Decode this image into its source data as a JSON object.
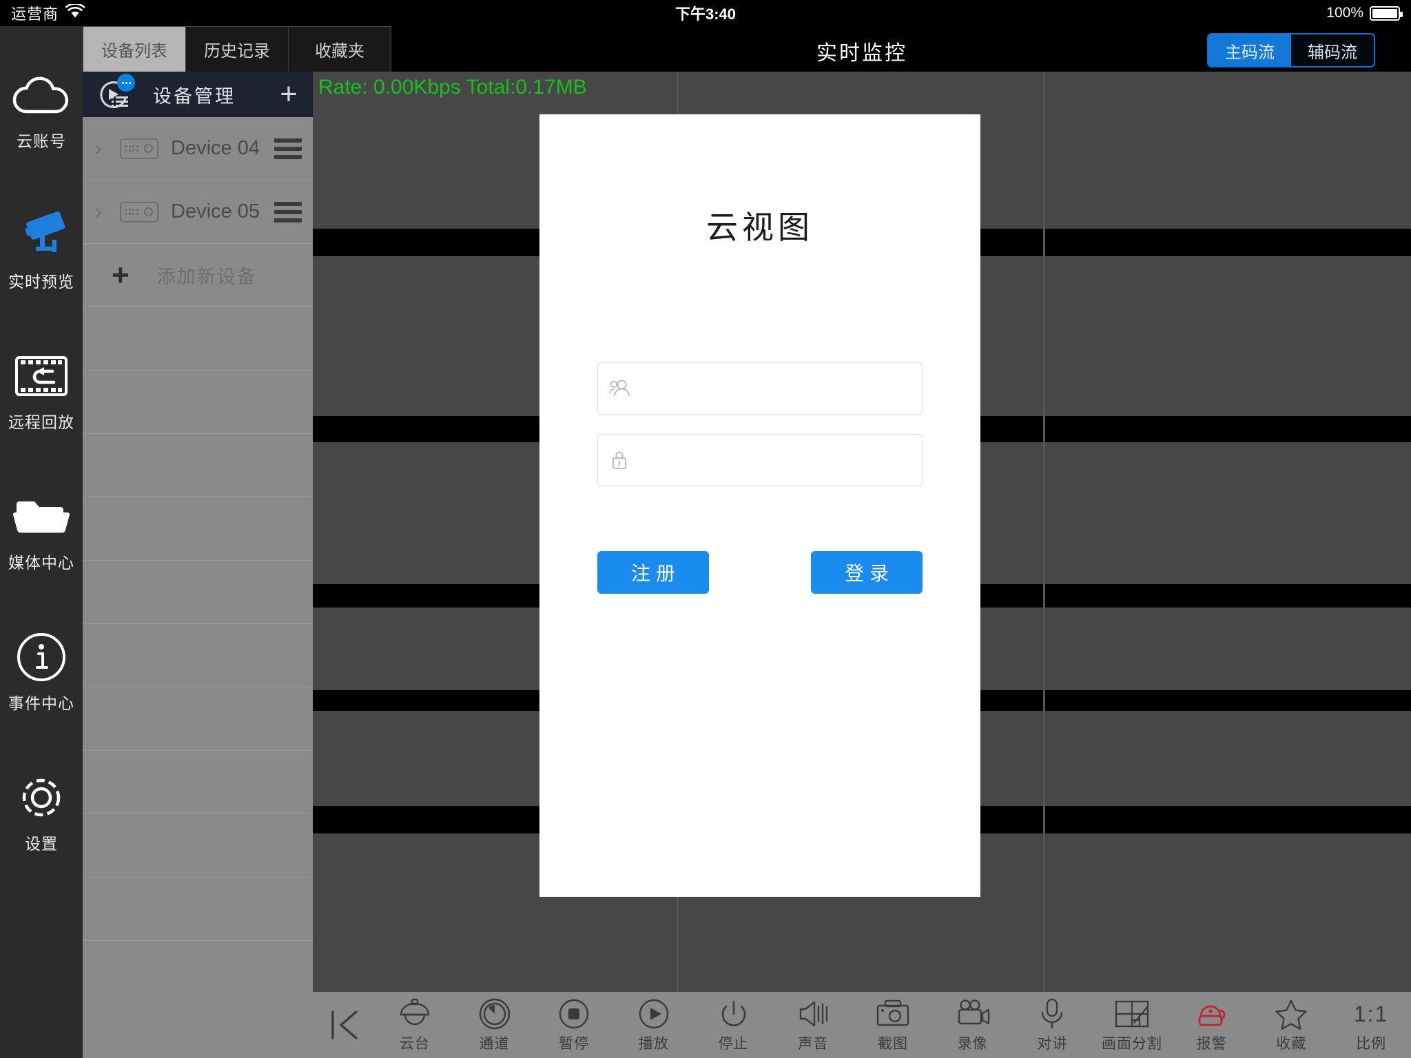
{
  "statusbar": {
    "carrier": "运营商",
    "wifi_icon": "wifi-icon",
    "time": "下午3:40",
    "battery_percent": "100%"
  },
  "sidebar": {
    "items": [
      {
        "label": "云账号",
        "icon": "cloud-icon",
        "active": false
      },
      {
        "label": "实时预览",
        "icon": "camera-icon",
        "active": true
      },
      {
        "label": "远程回放",
        "icon": "film-rewind-icon",
        "active": false
      },
      {
        "label": "媒体中心",
        "icon": "folder-icon",
        "active": false
      },
      {
        "label": "事件中心",
        "icon": "info-circle-icon",
        "active": false
      },
      {
        "label": "设置",
        "icon": "gear-icon",
        "active": false
      }
    ]
  },
  "tabs": [
    {
      "label": "设备列表",
      "active": true
    },
    {
      "label": "历史记录",
      "active": false
    },
    {
      "label": "收藏夹",
      "active": false
    }
  ],
  "device_panel": {
    "header_title": "设备管理",
    "header_icon": "device-play-list-icon",
    "add_icon": "plus-icon",
    "devices": [
      {
        "name": "Device 04",
        "expand_icon": "chevron-right-icon",
        "device_icon": "nvr-box-icon",
        "menu_icon": "hamburger-icon"
      },
      {
        "name": "Device 05",
        "expand_icon": "chevron-right-icon",
        "device_icon": "nvr-box-icon",
        "menu_icon": "hamburger-icon"
      }
    ],
    "add_new_label": "添加新设备",
    "add_new_icon": "plus-bold-icon",
    "empty_rows": 8
  },
  "main_header": {
    "title": "实时监控",
    "stream_options": [
      {
        "label": "主码流",
        "active": true
      },
      {
        "label": "辅码流",
        "active": false
      }
    ]
  },
  "video": {
    "rate_text": "Rate: 0.00Kbps Total:0.17MB",
    "rate_color": "#16c216",
    "selected_cell_border": "#2e8b8b"
  },
  "toolbar": {
    "back_icon": "skip-back-icon",
    "items": [
      {
        "label": "云台",
        "icon": "ptz-dome-icon",
        "color": "#3b3b3b"
      },
      {
        "label": "通道",
        "icon": "channel-icon",
        "color": "#3b3b3b"
      },
      {
        "label": "暂停",
        "icon": "pause-stop-icon",
        "color": "#3b3b3b"
      },
      {
        "label": "播放",
        "icon": "play-icon",
        "color": "#3b3b3b"
      },
      {
        "label": "停止",
        "icon": "power-icon",
        "color": "#3b3b3b"
      },
      {
        "label": "声音",
        "icon": "speaker-icon",
        "color": "#3b3b3b"
      },
      {
        "label": "截图",
        "icon": "camera-photo-icon",
        "color": "#3b3b3b"
      },
      {
        "label": "录像",
        "icon": "video-camera-icon",
        "color": "#3b3b3b"
      },
      {
        "label": "对讲",
        "icon": "microphone-icon",
        "color": "#3b3b3b"
      },
      {
        "label": "画面分割",
        "icon": "split-screen-icon",
        "color": "#3b3b3b"
      },
      {
        "label": "报警",
        "icon": "alarm-bell-icon",
        "color": "#c0272d"
      },
      {
        "label": "收藏",
        "icon": "star-icon",
        "color": "#3b3b3b"
      },
      {
        "label": "比例",
        "icon": "ratio-1-1-icon",
        "color": "#3b3b3b"
      }
    ],
    "ratio_text": "1:1"
  },
  "modal": {
    "title": "云视图",
    "username": {
      "value": "",
      "placeholder": "",
      "icon": "users-icon"
    },
    "password": {
      "value": "",
      "placeholder": "",
      "icon": "lock-icon"
    },
    "register_label": "注册",
    "login_label": "登录",
    "accent_color": "#1a8cf0"
  }
}
